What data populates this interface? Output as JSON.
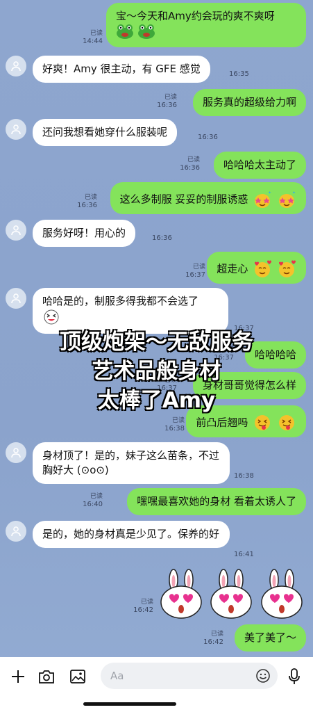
{
  "messages": [
    {
      "text": "宝～今天和Amy约会玩的爽不爽呀",
      "read": "已读",
      "time": "14:44"
    },
    {
      "text": "好爽！Amy 很主动，有 GFE 感觉",
      "time": "16:35"
    },
    {
      "text": "服务真的超级给力啊",
      "read": "已读",
      "time": "16:36"
    },
    {
      "text": "还问我想看她穿什么服装呢",
      "time": "16:36"
    },
    {
      "text": "哈哈哈太主动了",
      "read": "已读",
      "time": "16:36"
    },
    {
      "text": "这么多制服 妥妥的制服诱惑",
      "read": "已读",
      "time": "16:36"
    },
    {
      "text": "服务好呀！用心的",
      "time": "16:36"
    },
    {
      "text": "超走心",
      "read": "已读",
      "time": "16:37"
    },
    {
      "text": "哈哈是的，制服多得我都不会选了",
      "time": "16:37"
    },
    {
      "text": "哈哈哈哈",
      "read": "已读",
      "time": "16:37"
    },
    {
      "text": "身材哥哥觉得怎么样",
      "read": "已读",
      "time": "16:37"
    },
    {
      "text": "前凸后翘吗",
      "read": "已读",
      "time": "16:38"
    },
    {
      "text": "身材顶了！是的，妹子这么苗条，不过胸好大 (⊙o⊙)",
      "time": "16:38"
    },
    {
      "text": "嘿嘿最喜欢她的身材 看着太诱人了",
      "read": "已读",
      "time": "16:40"
    },
    {
      "text": "是的，她的身材真是少见了。保养的好",
      "time": "16:41"
    },
    {
      "read": "已读",
      "time": "16:42"
    },
    {
      "text": "美了美了～",
      "read": "已读",
      "time": "16:42"
    }
  ],
  "overlay": {
    "line1": "顶级炮架～无敌服务",
    "line2": "艺术品般身材",
    "line3": "太棒了Amy"
  },
  "input": {
    "placeholder": "Aa"
  },
  "icons": [
    "plus-icon",
    "camera-icon",
    "image-icon",
    "emoji-icon",
    "microphone-icon",
    "avatar-icon",
    "frog-emoji-icon",
    "star-eyes-emoji-icon",
    "heart-face-emoji-icon",
    "grin-emoji-icon",
    "tongue-emoji-icon",
    "bunny-sticker-icon"
  ],
  "colors": {
    "out_bubble": "#84e35b",
    "in_bubble": "#ffffff",
    "background": "#8ea6cf"
  }
}
